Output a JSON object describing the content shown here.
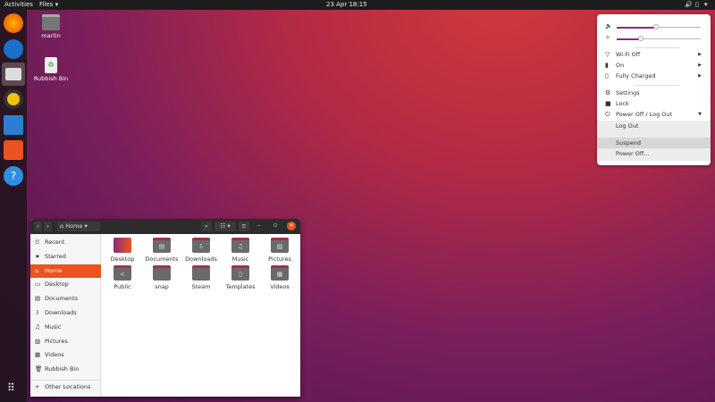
{
  "topbar": {
    "activities": "Activities",
    "app_menu": "Files ▾",
    "clock": "23 Apr  18:15",
    "status_icons": [
      "volume-icon",
      "battery-icon",
      "power-icon"
    ]
  },
  "dock": {
    "apps": [
      "firefox",
      "thunderbird",
      "files",
      "rhythmbox",
      "libreoffice-writer",
      "ubuntu-software",
      "help"
    ],
    "show_apps": "grid-icon"
  },
  "desktop": {
    "items": [
      {
        "label": "martin",
        "icon": "home-folder-icon"
      },
      {
        "label": "Rubbish Bin",
        "icon": "trash-icon"
      }
    ]
  },
  "system_menu": {
    "volume": 0.48,
    "brightness": 0.28,
    "items": [
      {
        "label": "Wi-Fi Off",
        "icon": "wifi-icon"
      },
      {
        "label": "On",
        "icon": "bluetooth-icon"
      },
      {
        "label": "Fully Charged",
        "icon": "battery-icon"
      },
      {
        "label": "Settings",
        "icon": "gear-icon"
      },
      {
        "label": "Lock",
        "icon": "lock-icon"
      },
      {
        "label": "Power Off / Log Out",
        "icon": "power-icon"
      }
    ],
    "submenu": [
      "Log Out",
      "Suspend",
      "Power Off…"
    ]
  },
  "files": {
    "location": "Home",
    "sidebar": [
      {
        "label": "Recent",
        "icon": "⏲"
      },
      {
        "label": "Starred",
        "icon": "★"
      },
      {
        "label": "Home",
        "icon": "⌂"
      },
      {
        "label": "Desktop",
        "icon": "▭"
      },
      {
        "label": "Documents",
        "icon": "▤"
      },
      {
        "label": "Downloads",
        "icon": "⇩"
      },
      {
        "label": "Music",
        "icon": "♫"
      },
      {
        "label": "Pictures",
        "icon": "▨"
      },
      {
        "label": "Videos",
        "icon": "▦"
      },
      {
        "label": "Rubbish Bin",
        "icon": "🗑"
      }
    ],
    "other_locations": "Other Locations",
    "folders": [
      {
        "label": "Desktop",
        "glyph": ""
      },
      {
        "label": "Documents",
        "glyph": "▤"
      },
      {
        "label": "Downloads",
        "glyph": "⇩"
      },
      {
        "label": "Music",
        "glyph": "♫"
      },
      {
        "label": "Pictures",
        "glyph": "▨"
      },
      {
        "label": "Public",
        "glyph": "<"
      },
      {
        "label": "snap",
        "glyph": ""
      },
      {
        "label": "Steam",
        "glyph": ""
      },
      {
        "label": "Templates",
        "glyph": "▯"
      },
      {
        "label": "Videos",
        "glyph": "▦"
      }
    ]
  },
  "colors": {
    "accent": "#e95420",
    "slider": "#8c2a7b"
  }
}
